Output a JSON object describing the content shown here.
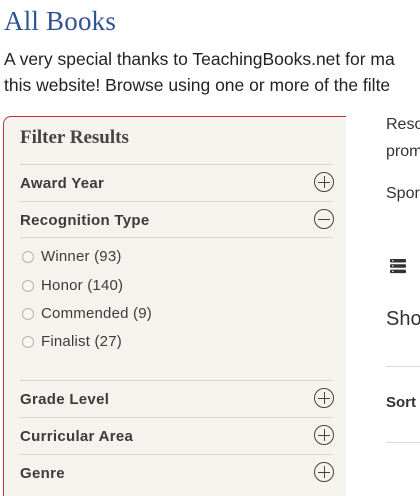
{
  "page": {
    "title": "All Books",
    "intro_line1": "A very special thanks to TeachingBooks.net for ma",
    "intro_line2": "this website! Browse using one or more of the filte"
  },
  "filters": {
    "header": "Filter Results",
    "award_year": "Award Year",
    "recognition_type": "Recognition Type",
    "options": [
      {
        "label": "Winner (93)"
      },
      {
        "label": "Honor (140)"
      },
      {
        "label": "Commended (9)"
      },
      {
        "label": "Finalist (27)"
      }
    ],
    "grade_level": "Grade Level",
    "curricular_area": "Curricular Area",
    "genre": "Genre"
  },
  "results": {
    "reso": "Reso",
    "prom": "prom",
    "spor": "Spor",
    "sho": "Sho",
    "sort": "Sort"
  },
  "colors": {
    "title_blue": "#2f5496",
    "panel_border": "#b9323c",
    "panel_bg": "#f5f3ee"
  },
  "icons": {
    "expand": "plus-circle-icon",
    "collapse": "minus-circle-icon",
    "list": "list-icon"
  }
}
